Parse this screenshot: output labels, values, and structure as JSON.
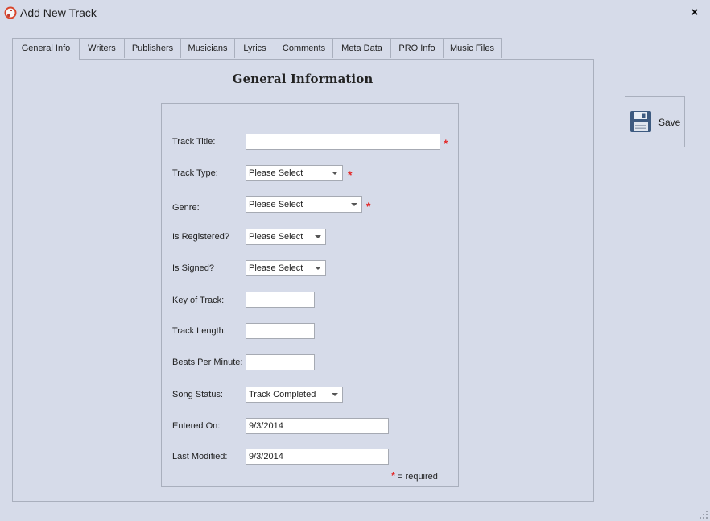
{
  "window": {
    "title": "Add New Track",
    "close_glyph": "×"
  },
  "tabs": [
    {
      "label": "General Info",
      "active": true
    },
    {
      "label": "Writers",
      "active": false
    },
    {
      "label": "Publishers",
      "active": false
    },
    {
      "label": "Musicians",
      "active": false
    },
    {
      "label": "Lyrics",
      "active": false
    },
    {
      "label": "Comments",
      "active": false
    },
    {
      "label": "Meta Data",
      "active": false
    },
    {
      "label": "PRO Info",
      "active": false
    },
    {
      "label": "Music Files",
      "active": false
    }
  ],
  "section": {
    "title": "General Information"
  },
  "form": {
    "track_title": {
      "label": "Track Title:",
      "value": "",
      "required": true
    },
    "track_type": {
      "label": "Track Type:",
      "value": "Please Select",
      "required": true
    },
    "genre": {
      "label": "Genre:",
      "value": "Please Select",
      "required": true
    },
    "is_registered": {
      "label": "Is Registered?",
      "value": "Please Select"
    },
    "is_signed": {
      "label": "Is Signed?",
      "value": "Please Select"
    },
    "key_of_track": {
      "label": "Key of Track:",
      "value": ""
    },
    "track_length": {
      "label": "Track Length:",
      "value": ""
    },
    "beats_per_minute": {
      "label": "Beats Per Minute:",
      "value": ""
    },
    "song_status": {
      "label": "Song Status:",
      "value": "Track Completed"
    },
    "entered_on": {
      "label": "Entered On:",
      "value": "9/3/2014"
    },
    "last_modified": {
      "label": "Last Modified:",
      "value": "9/3/2014"
    },
    "required_star": "*",
    "required_note": "= required"
  },
  "toolbar": {
    "save_label": "Save"
  },
  "colors": {
    "background": "#d6dbe9",
    "border": "#a9afbd",
    "required": "#e32b2b",
    "app_icon": "#d9452c"
  },
  "icons": {
    "app": "music-note-icon",
    "save": "floppy-disk-icon",
    "close": "close-icon",
    "dropdown": "chevron-down-icon"
  }
}
